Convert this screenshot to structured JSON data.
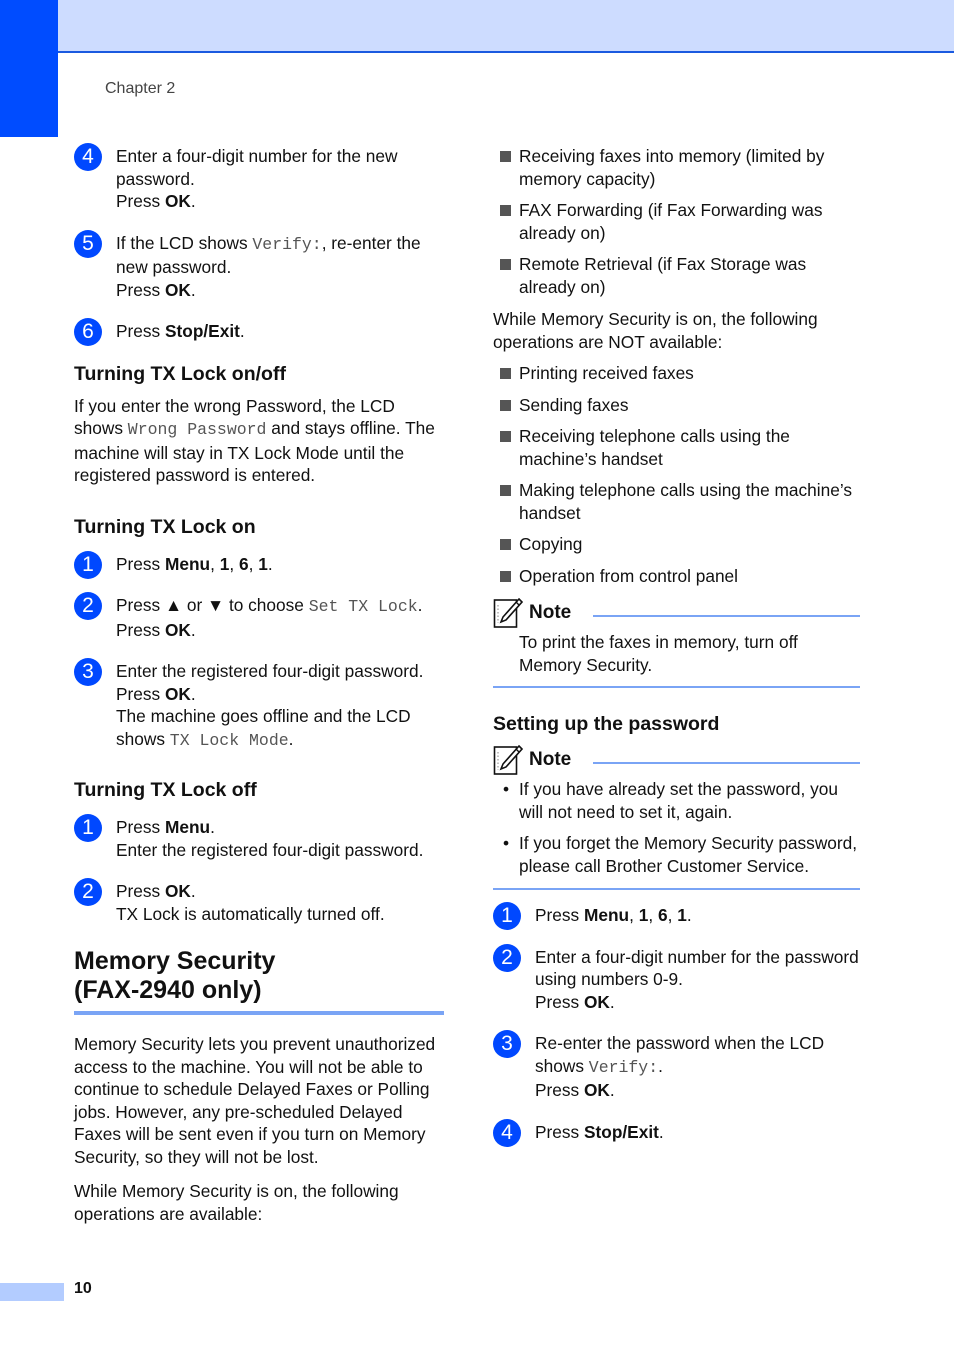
{
  "header": {
    "chapter": "Chapter 2"
  },
  "footer": {
    "page_number": "10"
  },
  "left": {
    "steps_top": [
      {
        "num": "4",
        "lines": [
          [
            {
              "t": "Enter a four-digit number for the new password."
            }
          ],
          [
            {
              "t": "Press "
            },
            {
              "t": "OK",
              "b": true
            },
            {
              "t": "."
            }
          ]
        ]
      },
      {
        "num": "5",
        "lines": [
          [
            {
              "t": "If the LCD shows "
            },
            {
              "t": "Verify:",
              "m": true
            },
            {
              "t": ", re-enter the new password."
            }
          ],
          [
            {
              "t": "Press "
            },
            {
              "t": "OK",
              "b": true
            },
            {
              "t": "."
            }
          ]
        ]
      },
      {
        "num": "6",
        "lines": [
          [
            {
              "t": "Press "
            },
            {
              "t": "Stop/Exit",
              "b": true
            },
            {
              "t": "."
            }
          ]
        ]
      }
    ],
    "section_onoff": {
      "title": "Turning TX Lock on/off",
      "para": [
        {
          "t": "If you enter the wrong Password, the LCD shows "
        },
        {
          "t": "Wrong Password",
          "m": true
        },
        {
          "t": " and stays offline. The machine will stay in TX Lock Mode until the registered password is entered."
        }
      ]
    },
    "section_on": {
      "title": "Turning TX Lock on",
      "steps": [
        {
          "num": "1",
          "lines": [
            [
              {
                "t": "Press "
              },
              {
                "t": "Menu",
                "b": true
              },
              {
                "t": ", "
              },
              {
                "t": "1",
                "b": true
              },
              {
                "t": ", "
              },
              {
                "t": "6",
                "b": true
              },
              {
                "t": ", "
              },
              {
                "t": "1",
                "b": true
              },
              {
                "t": "."
              }
            ]
          ]
        },
        {
          "num": "2",
          "lines": [
            [
              {
                "t": "Press ▲ or ▼ to choose "
              },
              {
                "t": "Set TX Lock",
                "m": true
              },
              {
                "t": "."
              }
            ],
            [
              {
                "t": "Press "
              },
              {
                "t": "OK",
                "b": true
              },
              {
                "t": "."
              }
            ]
          ]
        },
        {
          "num": "3",
          "lines": [
            [
              {
                "t": "Enter the registered four-digit password."
              }
            ],
            [
              {
                "t": "Press "
              },
              {
                "t": "OK",
                "b": true
              },
              {
                "t": "."
              }
            ],
            [
              {
                "t": "The machine goes offline and the LCD shows "
              },
              {
                "t": "TX Lock Mode",
                "m": true
              },
              {
                "t": "."
              }
            ]
          ]
        }
      ]
    },
    "section_off": {
      "title": "Turning TX Lock off",
      "steps": [
        {
          "num": "1",
          "lines": [
            [
              {
                "t": "Press "
              },
              {
                "t": "Menu",
                "b": true
              },
              {
                "t": "."
              }
            ],
            [
              {
                "t": "Enter the registered four-digit password."
              }
            ]
          ]
        },
        {
          "num": "2",
          "lines": [
            [
              {
                "t": "Press "
              },
              {
                "t": "OK",
                "b": true
              },
              {
                "t": "."
              }
            ],
            [
              {
                "t": "TX Lock is automatically turned off."
              }
            ]
          ]
        }
      ]
    },
    "memory_security": {
      "title_line1": "Memory Security",
      "title_line2": "(FAX-2940 only)",
      "para1": "Memory Security lets you prevent unauthorized access to the machine. You will not be able to continue to schedule Delayed Faxes or Polling jobs. However, any pre-scheduled Delayed Faxes will be sent even if you turn on Memory Security, so they will not be lost.",
      "para2": "While Memory Security is on, the following operations are available:"
    }
  },
  "right": {
    "available": [
      "Receiving faxes into memory (limited by memory capacity)",
      "FAX Forwarding (if Fax Forwarding was already on)",
      "Remote Retrieval (if Fax Storage was already on)"
    ],
    "not_available_intro": "While Memory Security is on, the following operations are NOT available:",
    "not_available": [
      "Printing received faxes",
      "Sending faxes",
      "Receiving telephone calls using the machine’s handset",
      "Making telephone calls using the machine’s handset",
      "Copying",
      "Operation from control panel"
    ],
    "note1": {
      "title": "Note",
      "text": "To print the faxes in memory, turn off Memory Security."
    },
    "setup": {
      "title": "Setting up the password",
      "note": {
        "title": "Note",
        "bullets": [
          "If you have already set the password, you will not need to set it, again.",
          "If you forget the Memory Security password, please call Brother Customer Service."
        ]
      },
      "steps": [
        {
          "num": "1",
          "lines": [
            [
              {
                "t": "Press "
              },
              {
                "t": "Menu",
                "b": true
              },
              {
                "t": ", "
              },
              {
                "t": "1",
                "b": true
              },
              {
                "t": ", "
              },
              {
                "t": "6",
                "b": true
              },
              {
                "t": ", "
              },
              {
                "t": "1",
                "b": true
              },
              {
                "t": "."
              }
            ]
          ]
        },
        {
          "num": "2",
          "lines": [
            [
              {
                "t": "Enter a four-digit number for the password using numbers 0-9."
              }
            ],
            [
              {
                "t": "Press "
              },
              {
                "t": "OK",
                "b": true
              },
              {
                "t": "."
              }
            ]
          ]
        },
        {
          "num": "3",
          "lines": [
            [
              {
                "t": "Re-enter the password when the LCD shows "
              },
              {
                "t": "Verify:",
                "m": true
              },
              {
                "t": "."
              }
            ],
            [
              {
                "t": "Press "
              },
              {
                "t": "OK",
                "b": true
              },
              {
                "t": "."
              }
            ]
          ]
        },
        {
          "num": "4",
          "lines": [
            [
              {
                "t": "Press "
              },
              {
                "t": "Stop/Exit",
                "b": true
              },
              {
                "t": "."
              }
            ]
          ]
        }
      ]
    }
  },
  "colors": {
    "accent_blue": "#004cff",
    "header_band": "#cddcff",
    "rule_blue": "#7aa4f5"
  }
}
